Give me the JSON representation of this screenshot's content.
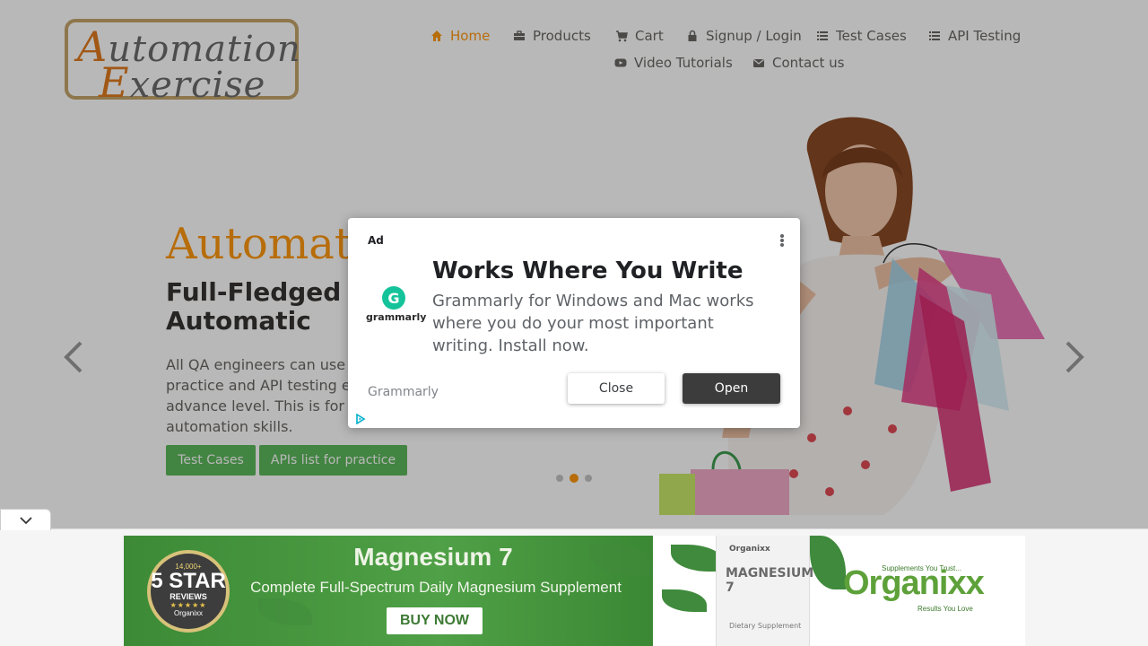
{
  "logo": {
    "line1_initial": "A",
    "line1_rest": "utomation",
    "line2_initial": "E",
    "line2_rest": "xercise"
  },
  "nav": {
    "items": [
      {
        "label": "Home",
        "icon": "home-icon"
      },
      {
        "label": "Products",
        "icon": "briefcase-icon"
      },
      {
        "label": "Cart",
        "icon": "cart-icon"
      },
      {
        "label": "Signup / Login",
        "icon": "lock-icon"
      },
      {
        "label": "Test Cases",
        "icon": "list-icon"
      },
      {
        "label": "API Testing",
        "icon": "list-icon"
      },
      {
        "label": "Video Tutorials",
        "icon": "youtube-icon"
      },
      {
        "label": "Contact us",
        "icon": "envelope-icon"
      }
    ]
  },
  "hero": {
    "title": "Automat",
    "subtitle": "Full-Fledged for Automatic",
    "text": "All QA engineers can use practice and API testing e advance level. This is for their automation skills.",
    "buttons": {
      "test_cases": "Test Cases",
      "apis": "APIs list for practice"
    }
  },
  "ad": {
    "label": "Ad",
    "brand_name": "grammarly",
    "brand_initial": "G",
    "headline": "Works Where You Write",
    "body": "Grammarly for Windows and Mac works where you do your most important writing. Install now.",
    "advertiser": "Grammarly",
    "close_label": "Close",
    "open_label": "Open"
  },
  "banner": {
    "badge_top": "14,000+",
    "badge_star": "5 STAR",
    "badge_reviews": "REVIEWS",
    "badge_stars": "★★★★★",
    "badge_brand": "Organixx",
    "title": "Magnesium 7",
    "subtitle": "Complete Full-Spectrum Daily Magnesium Supplement",
    "cta": "BUY NOW",
    "bottle_brand": "Organixx",
    "bottle_name": "MAGNESIUM 7",
    "bottle_note": "Dietary Supplement",
    "org_top": "Supplements You Trust...",
    "org_name": "Organixx",
    "org_tag": "Results You Love"
  },
  "colors": {
    "accent": "#fe980f",
    "green": "#5cb85c",
    "ad_open": "#3c3c3c"
  }
}
